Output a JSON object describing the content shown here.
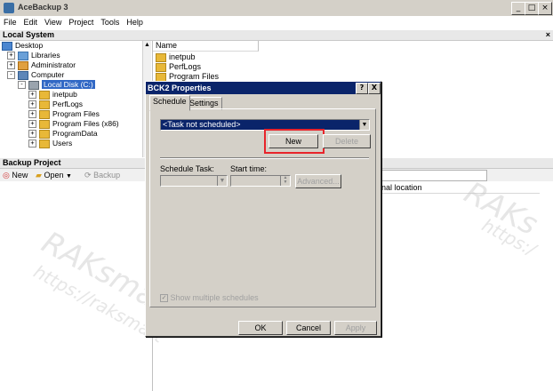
{
  "window": {
    "title": "AceBackup 3"
  },
  "menu": [
    "File",
    "Edit",
    "View",
    "Project",
    "Tools",
    "Help"
  ],
  "local_system": {
    "header": "Local System",
    "tree": [
      {
        "label": "Desktop",
        "icon": "desktop-icon",
        "level": 0
      },
      {
        "label": "Libraries",
        "icon": "libraries-icon",
        "level": 1,
        "expander": "+"
      },
      {
        "label": "Administrator",
        "icon": "user-folder-icon",
        "level": 1,
        "expander": "+"
      },
      {
        "label": "Computer",
        "icon": "computer-icon",
        "level": 1,
        "expander": "-"
      },
      {
        "label": "Local Disk (C:)",
        "icon": "drive-icon",
        "level": 2,
        "expander": "-",
        "selected": true
      },
      {
        "label": "inetpub",
        "icon": "folder-icon",
        "level": 3,
        "expander": "+"
      },
      {
        "label": "PerfLogs",
        "icon": "folder-icon",
        "level": 3,
        "expander": "+"
      },
      {
        "label": "Program Files",
        "icon": "folder-icon",
        "level": 3,
        "expander": "+"
      },
      {
        "label": "Program Files (x86)",
        "icon": "folder-icon",
        "level": 3,
        "expander": "+"
      },
      {
        "label": "ProgramData",
        "icon": "folder-icon",
        "level": 3,
        "expander": "+"
      },
      {
        "label": "Users",
        "icon": "folder-icon",
        "level": 3,
        "expander": "+"
      }
    ],
    "list_header": "Name",
    "list": [
      "inetpub",
      "PerfLogs",
      "Program Files"
    ],
    "close_glyph": "×"
  },
  "backup_project": {
    "header": "Backup Project",
    "toolbar": {
      "new": "New",
      "open": "Open",
      "backup": "Backup"
    },
    "column_right": "inal location"
  },
  "dialog": {
    "title": "BCK2 Properties",
    "help_glyph": "?",
    "close_glyph": "X",
    "tabs": [
      "Schedule",
      "Settings"
    ],
    "schedule_select": "<Task not scheduled>",
    "new_button": "New",
    "delete_button": "Delete",
    "schedule_task_label": "Schedule Task:",
    "start_time_label": "Start time:",
    "advanced_button": "Advanced...",
    "show_multiple": "Show multiple schedules",
    "ok_button": "OK",
    "cancel_button": "Cancel",
    "apply_button": "Apply"
  },
  "colors": {
    "highlight": "#e8242b",
    "titlebar": "#0a246a",
    "selection": "#3168c5"
  }
}
